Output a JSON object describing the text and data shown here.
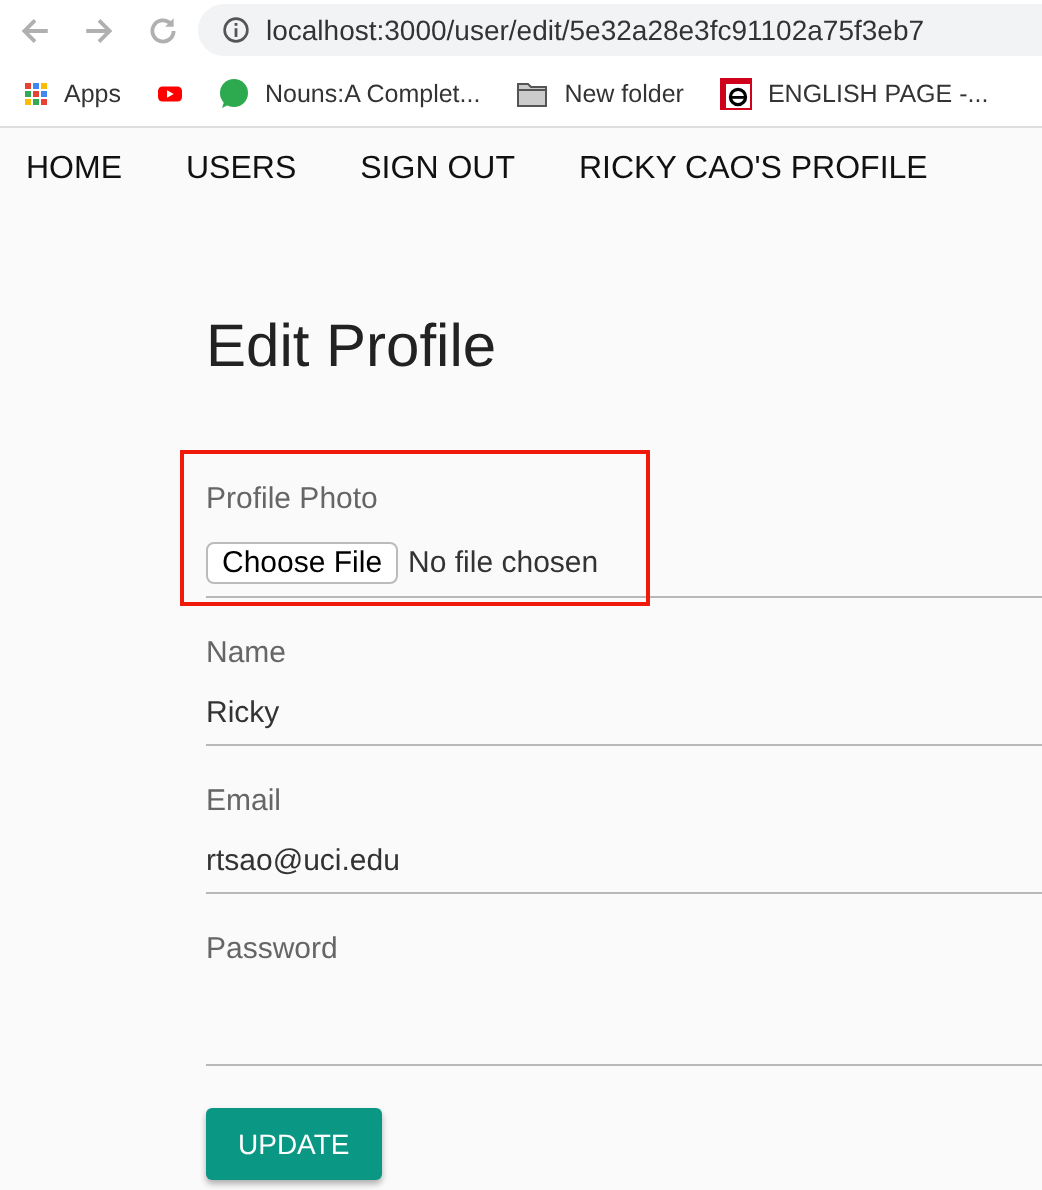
{
  "browser": {
    "url": "localhost:3000/user/edit/5e32a28e3fc91102a75f3eb7",
    "bookmarks": [
      {
        "kind": "apps",
        "label": "Apps"
      },
      {
        "kind": "video"
      },
      {
        "kind": "site",
        "label": "Nouns:A Complet..."
      },
      {
        "kind": "folder",
        "label": "New folder"
      },
      {
        "kind": "letter",
        "label": "ENGLISH PAGE -..."
      }
    ]
  },
  "nav": [
    "HOME",
    "USERS",
    "SIGN OUT",
    "RICKY CAO'S PROFILE"
  ],
  "title": "Edit Profile",
  "photo_field": {
    "label": "Profile Photo",
    "button": "Choose File",
    "status": "No file chosen",
    "highlighted": true
  },
  "fields": [
    {
      "label": "Name",
      "value": "Ricky"
    },
    {
      "label": "Email",
      "value": "rtsao@uci.edu"
    },
    {
      "label": "Password"
    }
  ],
  "submit": "UPDATE"
}
